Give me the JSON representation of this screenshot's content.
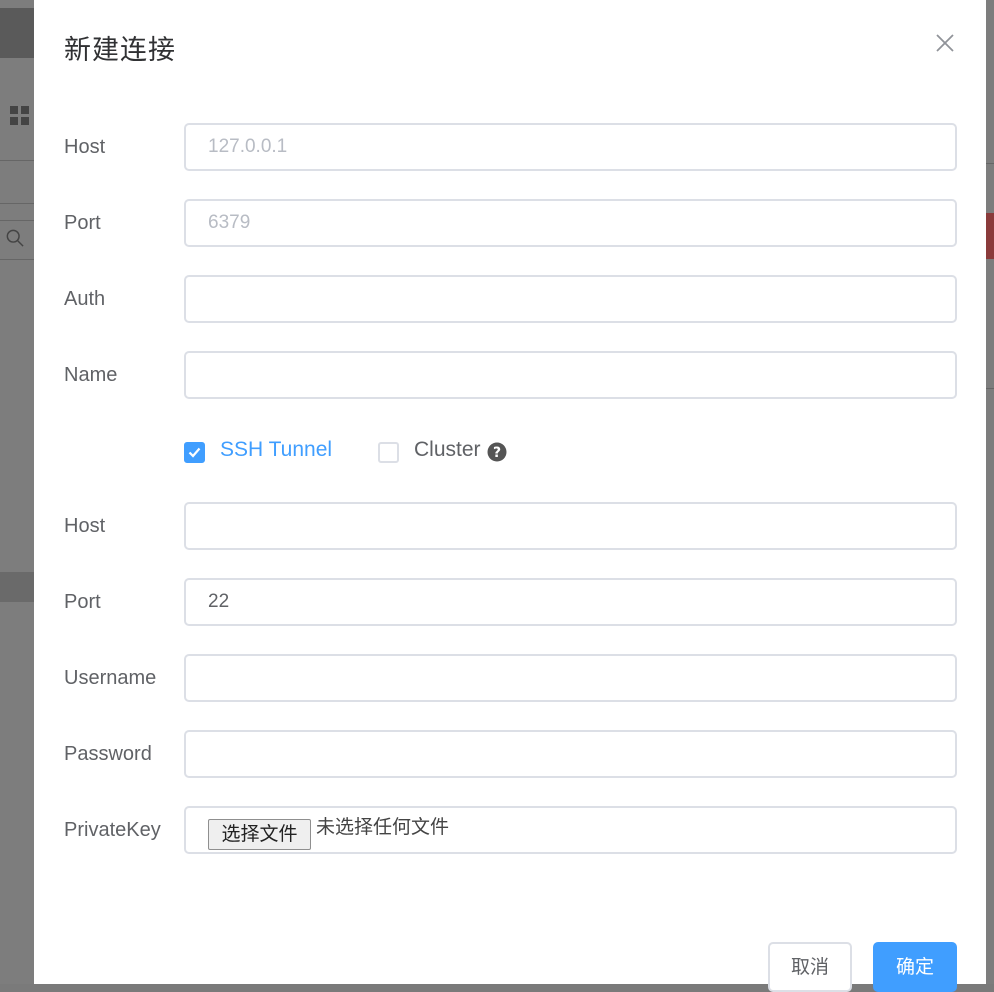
{
  "dialog": {
    "title": "新建连接"
  },
  "fields": {
    "host": {
      "label": "Host",
      "value": "",
      "placeholder": "127.0.0.1"
    },
    "port": {
      "label": "Port",
      "value": "",
      "placeholder": "6379"
    },
    "auth": {
      "label": "Auth",
      "value": "",
      "placeholder": ""
    },
    "name": {
      "label": "Name",
      "value": "",
      "placeholder": ""
    }
  },
  "options": {
    "ssh_tunnel": {
      "label": "SSH Tunnel",
      "checked": true
    },
    "cluster": {
      "label": "Cluster",
      "checked": false
    }
  },
  "ssh": {
    "host": {
      "label": "Host",
      "value": "",
      "placeholder": ""
    },
    "port": {
      "label": "Port",
      "value": "22",
      "placeholder": ""
    },
    "username": {
      "label": "Username",
      "value": "",
      "placeholder": ""
    },
    "password": {
      "label": "Password",
      "value": "",
      "placeholder": ""
    },
    "private_key": {
      "label": "PrivateKey",
      "button_label": "选择文件",
      "status": "未选择任何文件"
    }
  },
  "footer": {
    "cancel_label": "取消",
    "ok_label": "确定"
  },
  "colors": {
    "accent": "#409eff",
    "text": "#606266",
    "border": "#dcdfe6"
  }
}
